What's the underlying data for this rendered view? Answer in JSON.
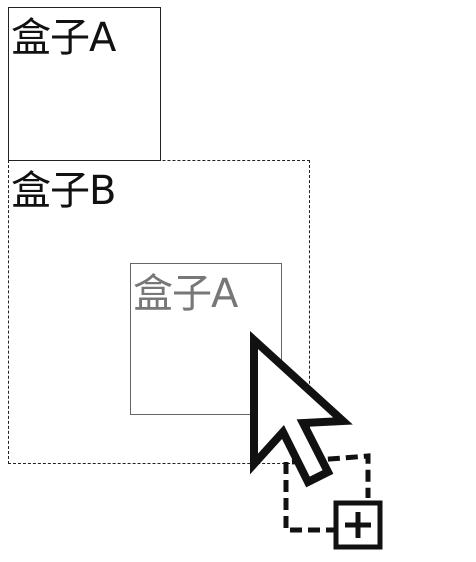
{
  "boxes": {
    "box_a": {
      "label": "盒子A"
    },
    "box_b": {
      "label": "盒子B"
    },
    "box_a_ghost": {
      "label": "盒子A"
    }
  },
  "icons": {
    "cursor": "arrow-pointer-icon",
    "drag_copy": "drag-copy-plus-icon"
  }
}
